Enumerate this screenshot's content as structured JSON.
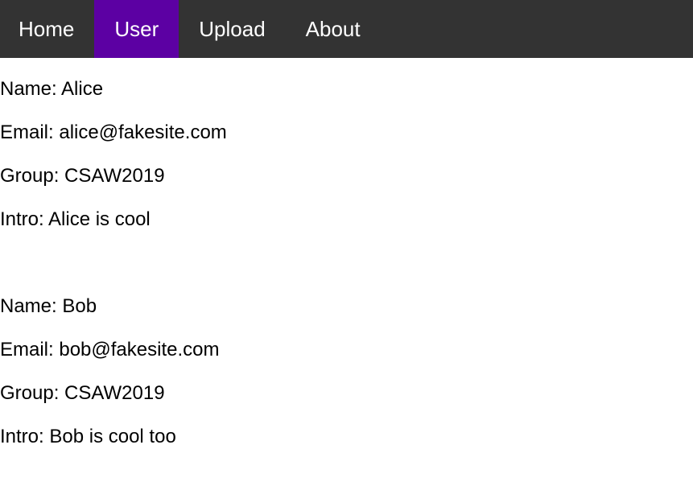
{
  "nav": {
    "items": [
      {
        "label": "Home"
      },
      {
        "label": "User",
        "active": true
      },
      {
        "label": "Upload"
      },
      {
        "label": "About"
      }
    ],
    "bg_color": "#333333",
    "active_color": "#5c00a3"
  },
  "users": [
    {
      "name": "Name: Alice",
      "email": "Email: alice@fakesite.com",
      "group": "Group: CSAW2019",
      "intro": "Intro: Alice is cool"
    },
    {
      "name": "Name: Bob",
      "email": "Email: bob@fakesite.com",
      "group": "Group: CSAW2019",
      "intro": "Intro: Bob is cool too"
    }
  ]
}
